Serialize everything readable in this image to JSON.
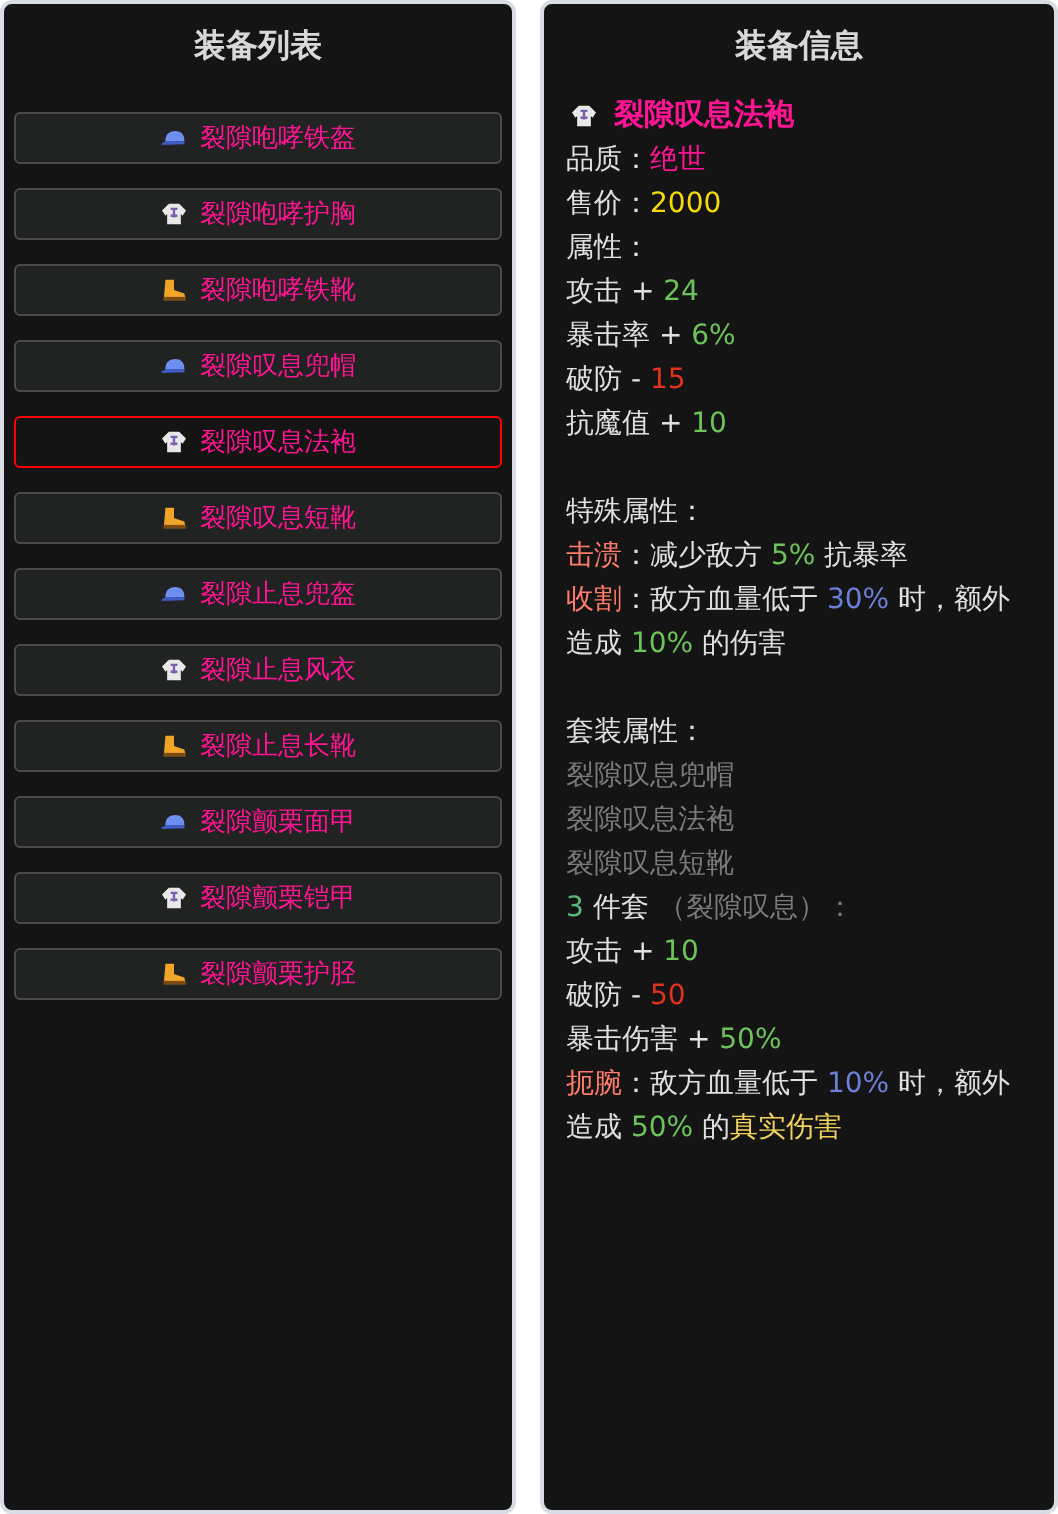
{
  "list_panel": {
    "title": "装备列表",
    "items": [
      {
        "kind": "helmet",
        "name": "裂隙咆哮铁盔",
        "selected": false
      },
      {
        "kind": "armor",
        "name": "裂隙咆哮护胸",
        "selected": false
      },
      {
        "kind": "boots",
        "name": "裂隙咆哮铁靴",
        "selected": false
      },
      {
        "kind": "helmet",
        "name": "裂隙叹息兜帽",
        "selected": false
      },
      {
        "kind": "armor",
        "name": "裂隙叹息法袍",
        "selected": true
      },
      {
        "kind": "boots",
        "name": "裂隙叹息短靴",
        "selected": false
      },
      {
        "kind": "helmet",
        "name": "裂隙止息兜盔",
        "selected": false
      },
      {
        "kind": "armor",
        "name": "裂隙止息风衣",
        "selected": false
      },
      {
        "kind": "boots",
        "name": "裂隙止息长靴",
        "selected": false
      },
      {
        "kind": "helmet",
        "name": "裂隙颤栗面甲",
        "selected": false
      },
      {
        "kind": "armor",
        "name": "裂隙颤栗铠甲",
        "selected": false
      },
      {
        "kind": "boots",
        "name": "裂隙颤栗护胫",
        "selected": false
      }
    ]
  },
  "detail_panel": {
    "title": "装备信息",
    "item": {
      "kind": "armor",
      "name": "裂隙叹息法袍"
    },
    "sections": [
      {
        "lines": [
          [
            {
              "text": "品质：",
              "color": "#e0e0e0"
            },
            {
              "text": "绝世",
              "color": "#ff1493"
            }
          ],
          [
            {
              "text": "售价：",
              "color": "#e0e0e0"
            },
            {
              "text": "2000",
              "color": "#f5d90a"
            }
          ],
          [
            {
              "text": "属性：",
              "color": "#e0e0e0"
            }
          ],
          [
            {
              "text": "攻击 + ",
              "color": "#e0e0e0"
            },
            {
              "text": "24",
              "color": "#6dc35a"
            }
          ],
          [
            {
              "text": "暴击率 + ",
              "color": "#e0e0e0"
            },
            {
              "text": "6%",
              "color": "#6dc35a"
            }
          ],
          [
            {
              "text": "破防 - ",
              "color": "#e0e0e0"
            },
            {
              "text": "15",
              "color": "#e0321e"
            }
          ],
          [
            {
              "text": "抗魔值 + ",
              "color": "#e0e0e0"
            },
            {
              "text": "10",
              "color": "#6dc35a"
            }
          ]
        ]
      },
      {
        "lines": [
          [
            {
              "text": "特殊属性：",
              "color": "#e0e0e0"
            }
          ],
          [
            {
              "text": "击溃",
              "color": "#ff7b6b"
            },
            {
              "text": "：减少敌方 ",
              "color": "#e0e0e0"
            },
            {
              "text": "5%",
              "color": "#6dc35a"
            },
            {
              "text": " 抗暴率",
              "color": "#e0e0e0"
            }
          ],
          [
            {
              "text": "收割",
              "color": "#ff7b6b"
            },
            {
              "text": "：敌方血量低于 ",
              "color": "#e0e0e0"
            },
            {
              "text": "30%",
              "color": "#6b7fd6"
            },
            {
              "text": " 时，额外造成 ",
              "color": "#e0e0e0"
            },
            {
              "text": "10%",
              "color": "#6dc35a"
            },
            {
              "text": " 的伤害",
              "color": "#e0e0e0"
            }
          ]
        ]
      },
      {
        "lines": [
          [
            {
              "text": "套装属性：",
              "color": "#e0e0e0"
            }
          ],
          [
            {
              "text": "裂隙叹息兜帽",
              "color": "#7a7a7a"
            }
          ],
          [
            {
              "text": "裂隙叹息法袍",
              "color": "#7a7a7a"
            }
          ],
          [
            {
              "text": "裂隙叹息短靴",
              "color": "#7a7a7a"
            }
          ],
          [
            {
              "text": "3",
              "color": "#5cb87a"
            },
            {
              "text": " 件套 ",
              "color": "#e0e0e0"
            },
            {
              "text": "（裂隙叹息）：",
              "color": "#7a7a7a"
            }
          ],
          [
            {
              "text": "攻击 + ",
              "color": "#e0e0e0"
            },
            {
              "text": "10",
              "color": "#6dc35a"
            }
          ],
          [
            {
              "text": "破防 - ",
              "color": "#e0e0e0"
            },
            {
              "text": "50",
              "color": "#e0321e"
            }
          ],
          [
            {
              "text": "暴击伤害 + ",
              "color": "#e0e0e0"
            },
            {
              "text": "50%",
              "color": "#6dc35a"
            }
          ],
          [
            {
              "text": "扼腕",
              "color": "#ff7b6b"
            },
            {
              "text": "：敌方血量低于 ",
              "color": "#e0e0e0"
            },
            {
              "text": "10%",
              "color": "#6b7fd6"
            },
            {
              "text": " 时，额外造成 ",
              "color": "#e0e0e0"
            },
            {
              "text": "50%",
              "color": "#6dc35a"
            },
            {
              "text": " 的",
              "color": "#e0e0e0"
            },
            {
              "text": "真实伤害",
              "color": "#f2d45c"
            }
          ]
        ]
      }
    ]
  }
}
